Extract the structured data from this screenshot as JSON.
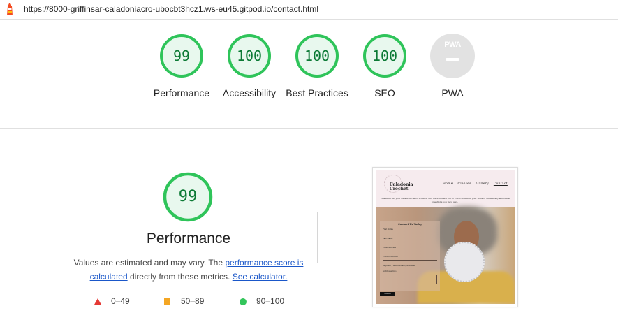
{
  "topbar": {
    "icon": "lighthouse-icon",
    "url": "https://8000-griffinsar-caladoniacro-ubocbt3hcz1.ws-eu45.gitpod.io/contact.html"
  },
  "scores": [
    {
      "value": "99",
      "label": "Performance"
    },
    {
      "value": "100",
      "label": "Accessibility"
    },
    {
      "value": "100",
      "label": "Best Practices"
    },
    {
      "value": "100",
      "label": "SEO"
    }
  ],
  "pwa": {
    "badge_text": "PWA",
    "label": "PWA"
  },
  "performance": {
    "score": "99",
    "title": "Performance",
    "desc_before": "Values are estimated and may vary. The ",
    "link1": "performance score is calculated",
    "desc_middle": " directly from these metrics. ",
    "link2": "See calculator."
  },
  "legend": [
    {
      "range": "0–49",
      "shape": "triangle",
      "color": "#e53935"
    },
    {
      "range": "50–89",
      "shape": "square",
      "color": "#f4a623"
    },
    {
      "range": "90–100",
      "shape": "circle",
      "color": "#33c55b"
    }
  ],
  "colors": {
    "pass": "#0cce6b",
    "pass_text": "#0c7a35",
    "pass_fill": "#e5f8ec",
    "neutral": "#e0e0e0"
  },
  "thumbnail": {
    "logo_line1": "Caladonia",
    "logo_line2": "Crochet",
    "nav": [
      "Home",
      "Classes",
      "Gallery",
      "Contact"
    ],
    "intro": "Please fill out your details in the form below and we will reach out to you to schedule your class or answer any additional questions you may have.",
    "form_title": "Contact Us Today",
    "fields": [
      "First Name",
      "Last Name",
      "Email Address",
      "Contact Number",
      "Beginner / Intermediate / Advanced",
      "Additional Info"
    ],
    "submit": "Submit"
  }
}
